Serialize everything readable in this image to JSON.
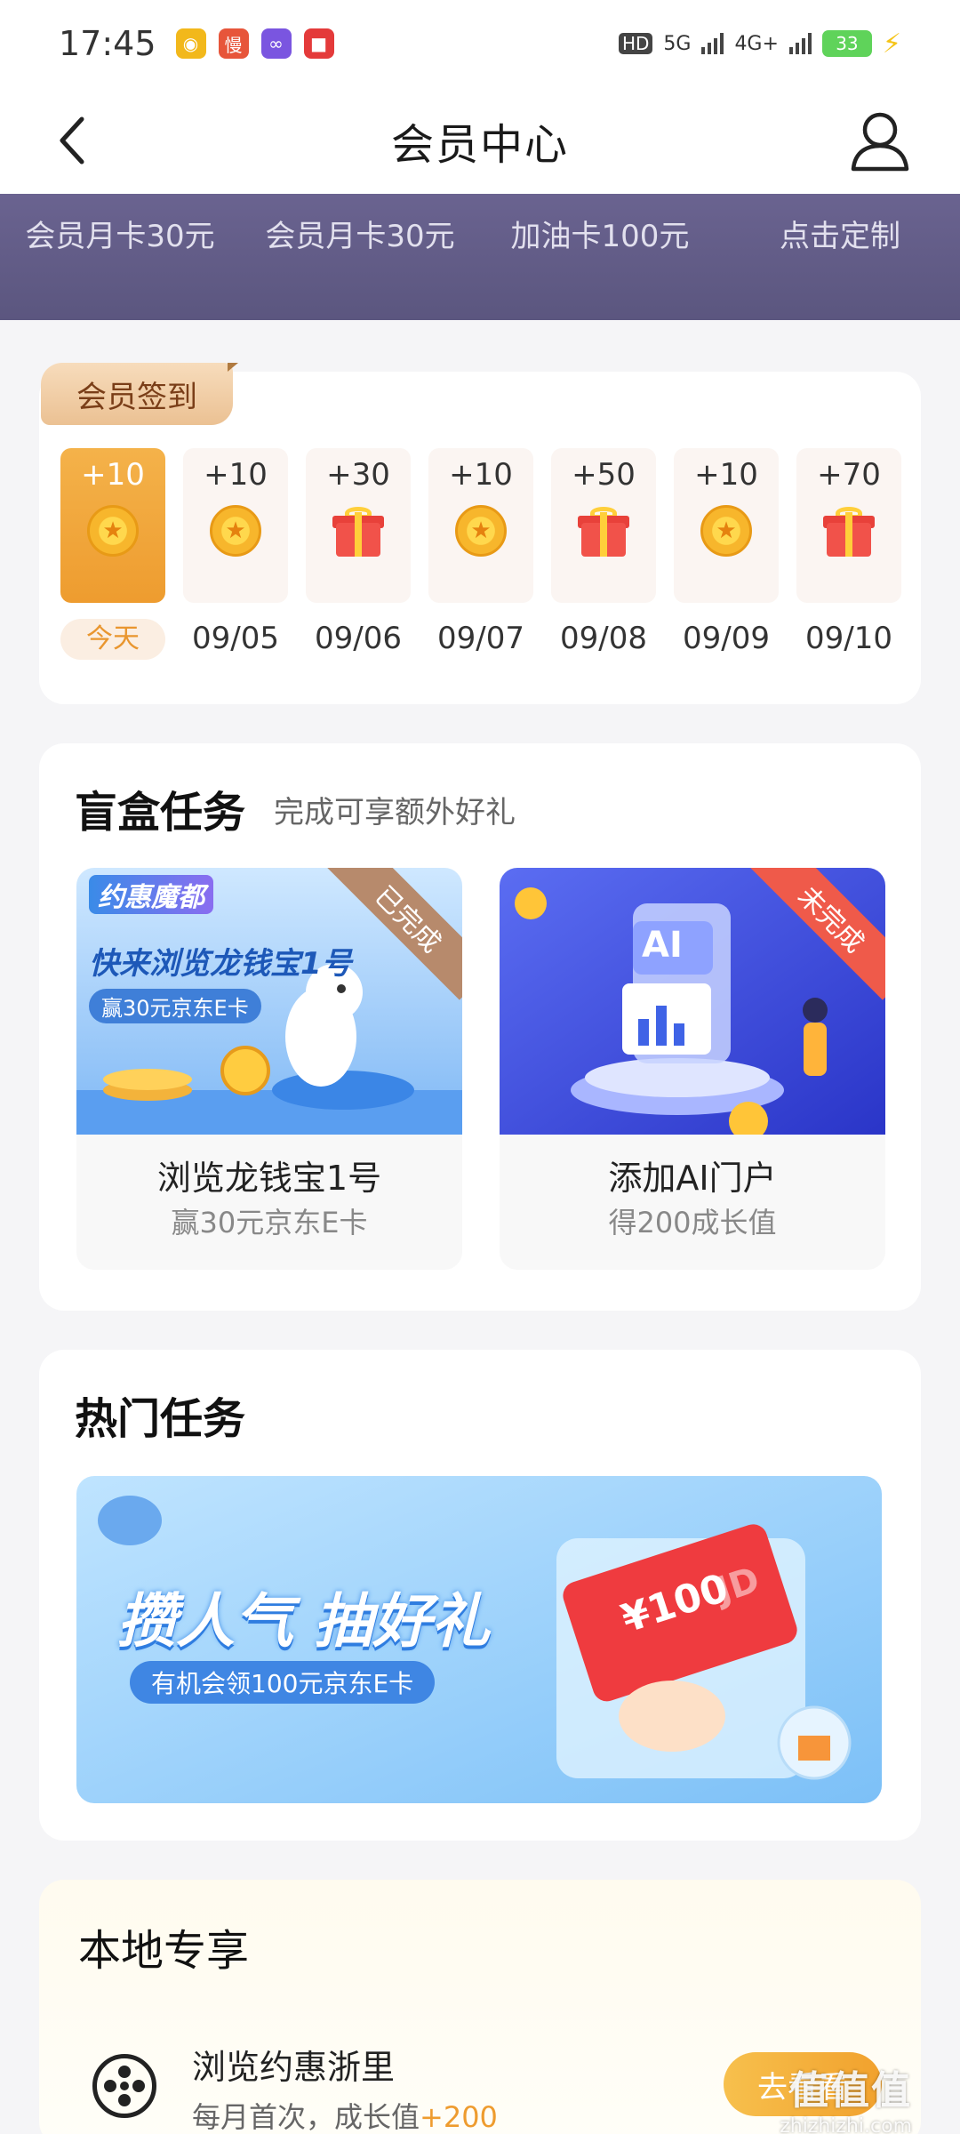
{
  "status_bar": {
    "time": "17:45",
    "apps": [
      {
        "icon": "weibo-icon",
        "glyph": "◉",
        "color": "#f2b81b"
      },
      {
        "icon": "mangguo-icon",
        "glyph": "慢",
        "color": "#e7553a"
      },
      {
        "icon": "soul-icon",
        "glyph": "∞",
        "color": "#7a55e0"
      },
      {
        "icon": "pdd-icon",
        "glyph": "■",
        "color": "#e43a3a"
      }
    ],
    "hd_label": "HD",
    "net1": "5G",
    "net2": "4G+",
    "battery": "33"
  },
  "nav": {
    "title": "会员中心"
  },
  "benefits": [
    {
      "label": "会员月卡30元"
    },
    {
      "label": "会员月卡30元"
    },
    {
      "label": "加油卡100元"
    },
    {
      "label": "点击定制"
    }
  ],
  "signin": {
    "tag": "会员签到",
    "days": [
      {
        "points": "+10",
        "reward": "coin",
        "date": "今天",
        "active": true
      },
      {
        "points": "+10",
        "reward": "coin",
        "date": "09/05"
      },
      {
        "points": "+30",
        "reward": "gift",
        "date": "09/06"
      },
      {
        "points": "+10",
        "reward": "coin",
        "date": "09/07"
      },
      {
        "points": "+50",
        "reward": "gift",
        "date": "09/08"
      },
      {
        "points": "+10",
        "reward": "coin",
        "date": "09/09"
      },
      {
        "points": "+70",
        "reward": "gift",
        "date": "09/10"
      }
    ]
  },
  "blind_box": {
    "title": "盲盒任务",
    "subtitle": "完成可享额外好礼",
    "tasks": [
      {
        "name": "浏览龙钱宝1号",
        "desc": "赢30元京东E卡",
        "status": "已完成",
        "status_color": "#b78a6c",
        "banner_tag": "约惠魔都",
        "banner_title": "快来浏览龙钱宝1号",
        "banner_sub": "赢30元京东E卡"
      },
      {
        "name": "添加AI门户",
        "desc": "得200成长值",
        "status": "未完成",
        "status_color": "#ef5a4a",
        "banner_ai": "AI"
      }
    ]
  },
  "hot": {
    "title": "热门任务",
    "banner_title": "攒人气 抽好礼",
    "banner_sub": "有机会领100元京东E卡",
    "card_amount": "¥100",
    "card_brand": "JD"
  },
  "local": {
    "title": "本地专享",
    "item_name": "浏览约惠浙里",
    "item_desc": "每月首次，成长值",
    "item_plus": "+200",
    "button": "去看看"
  },
  "watermark": {
    "line1": "值值值",
    "line2": "zhizhizhi.com"
  }
}
